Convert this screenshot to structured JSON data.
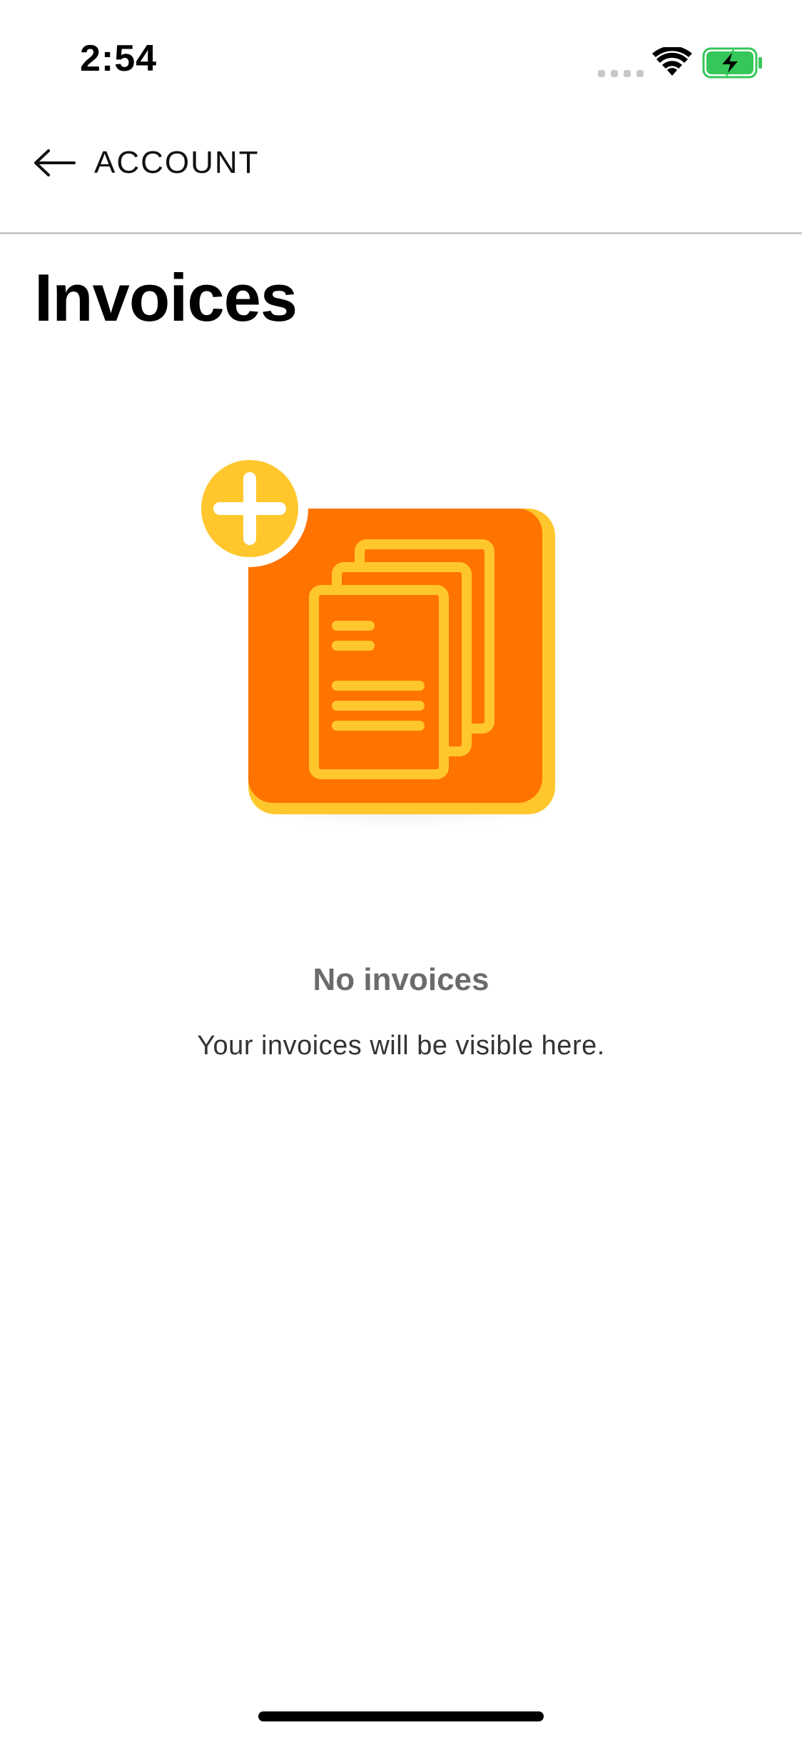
{
  "status_bar": {
    "time": "2:54",
    "signal_icon": "cellular-signal-icon",
    "wifi_icon": "wifi-icon",
    "battery_icon": "battery-charging-icon",
    "battery_color": "#35c759"
  },
  "nav": {
    "back_icon": "arrow-left-icon",
    "back_label": "ACCOUNT"
  },
  "page": {
    "title": "Invoices"
  },
  "empty_state": {
    "illustration_icon": "invoices-add-illustration",
    "title": "No invoices",
    "subtitle": "Your invoices will be visible here.",
    "colors": {
      "card": "#ff7300",
      "accent": "#ffc72c"
    }
  }
}
